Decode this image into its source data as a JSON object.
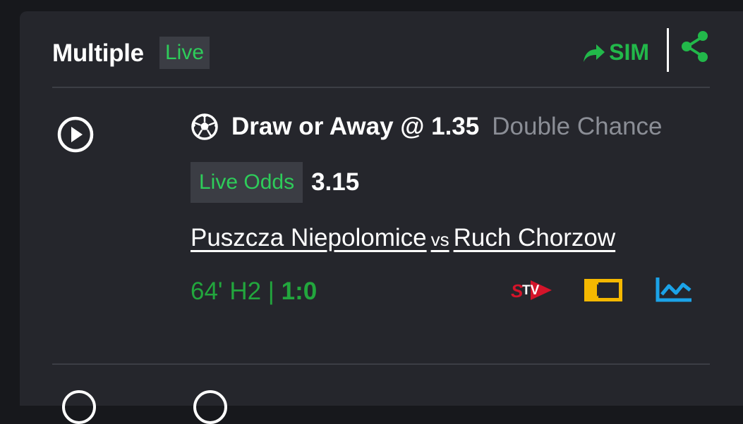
{
  "header": {
    "title": "Multiple",
    "live_badge": "Live",
    "sim_label": "SIM",
    "share_icon": "share-icon",
    "sim_icon": "forward-arrow-icon"
  },
  "selection": {
    "pick": "Draw or Away @ 1.35",
    "market": "Double Chance",
    "sport_icon": "soccer-ball-icon",
    "play_icon": "play-icon"
  },
  "odds": {
    "label": "Live Odds",
    "value": "3.15"
  },
  "match": {
    "home": "Puszcza Niepolomice",
    "vs": "vs",
    "away": "Ruch Chorzow"
  },
  "status": {
    "time": "64' H2 | ",
    "score": "1:0"
  },
  "action_icons": [
    "stv-icon",
    "video-stream-icon",
    "stats-chart-icon"
  ],
  "colors": {
    "accent_green": "#22b84a",
    "live_green": "#2ecc5a",
    "stv_red": "#d4142a",
    "stream_yellow": "#f5b800",
    "chart_blue": "#1ba3e8",
    "card_bg": "#25262c"
  }
}
